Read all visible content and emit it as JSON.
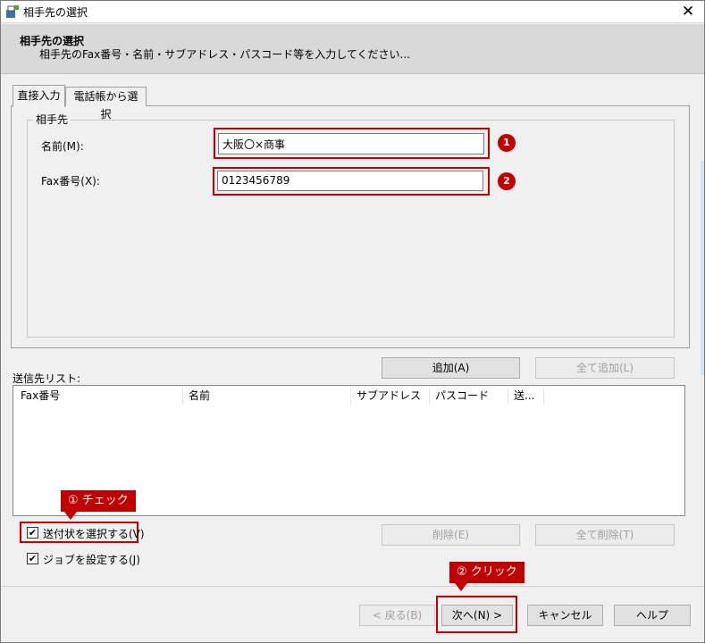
{
  "window": {
    "title": "相手先の選択",
    "close_glyph": "✕"
  },
  "header": {
    "title": "相手先の選択",
    "subtitle": "相手先のFax番号・名前・サブアドレス・パスコード等を入力してください..."
  },
  "tabs": [
    {
      "label": "直接入力",
      "active": true
    },
    {
      "label": "電話帳から選択",
      "active": false
    }
  ],
  "recipient_group": {
    "legend": "相手先",
    "name_label": "名前(M):",
    "name_value": "大阪〇×商事",
    "fax_label": "Fax番号(X):",
    "fax_value": "0123456789",
    "badge_1": "1",
    "badge_2": "2"
  },
  "buttons": {
    "add": "追加(A)",
    "add_all": "全て追加(L)",
    "delete": "削除(E)",
    "delete_all": "全て削除(T)",
    "back": "< 戻る(B)",
    "next": "次へ(N) >",
    "cancel": "キャンセル",
    "help": "ヘルプ"
  },
  "send_list": {
    "label": "送信先リスト:",
    "columns": [
      "Fax番号",
      "名前",
      "サブアドレス",
      "パスコード",
      "送..."
    ]
  },
  "options": {
    "cover_sheet_label": "送付状を選択する(V)",
    "cover_sheet_checked": true,
    "job_settings_label": "ジョブを設定する(J)",
    "job_settings_checked": true,
    "check_glyph": "✔"
  },
  "callouts": {
    "check": "① チェック",
    "click": "② クリック"
  },
  "colors": {
    "annotation_red": "#c00000",
    "header_bg": "#d9d9d9",
    "dialog_bg": "#f0f0f0"
  }
}
